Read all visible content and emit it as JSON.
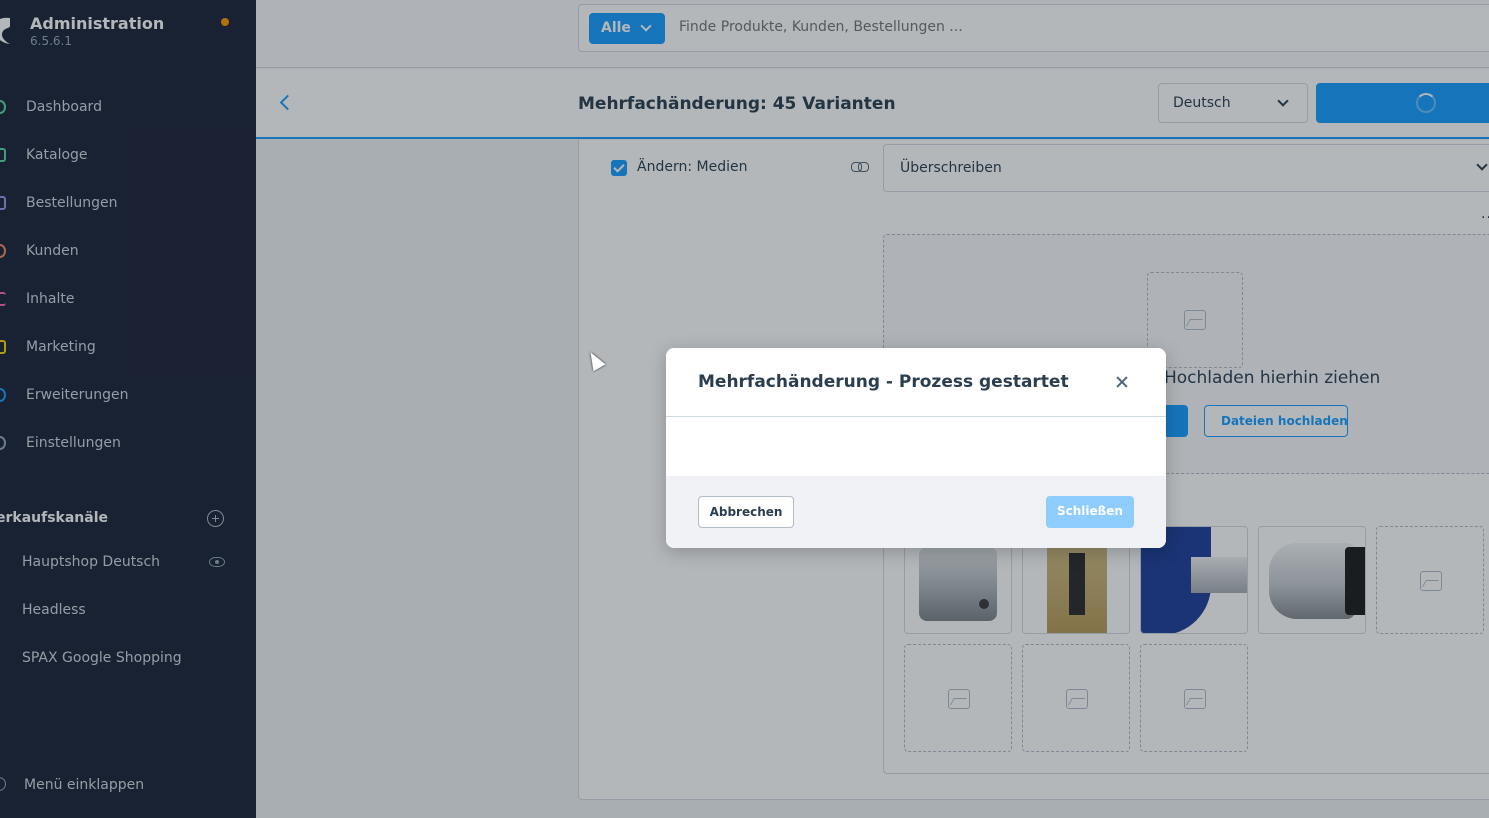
{
  "app": {
    "title": "Administration",
    "version": "6.5.6.1"
  },
  "sidebar": {
    "items": [
      {
        "label": "Dashboard",
        "color": "#57d9a3"
      },
      {
        "label": "Kataloge",
        "color": "#57d9a3"
      },
      {
        "label": "Bestellungen",
        "color": "#a092f0"
      },
      {
        "label": "Kunden",
        "color": "#f88962"
      },
      {
        "label": "Inhalte",
        "color": "#ff68b4"
      },
      {
        "label": "Marketing",
        "color": "#ffd700"
      },
      {
        "label": "Erweiterungen",
        "color": "#189eff"
      },
      {
        "label": "Einstellungen",
        "color": "#9aa8b5"
      }
    ],
    "sales_channels_title": "erkaufskanäle",
    "channels": [
      {
        "label": "Hauptshop Deutsch"
      },
      {
        "label": "Headless"
      },
      {
        "label": "SPAX Google Shopping"
      }
    ],
    "collapse_label": "Menü einklappen"
  },
  "search": {
    "type_label": "Alle",
    "placeholder": "Finde Produkte, Kunden, Bestellungen ..."
  },
  "smartbar": {
    "title": "Mehrfachänderung: 45 Varianten",
    "language": "Deutsch"
  },
  "form": {
    "change_label": "Ändern: Medien",
    "change_checked": true,
    "mode": "Überschreiben",
    "more": "..",
    "upload_text": "Hochladen hierhin ziehen",
    "upload_button": "Dateien hochladen"
  },
  "modal": {
    "title": "Mehrfachänderung - Prozess gestartet",
    "cancel_label": "Abbrechen",
    "close_label": "Schließen"
  },
  "colors": {
    "brand": "#189eff",
    "sidebar_bg": "#1d2438",
    "notification": "#ff9800"
  }
}
